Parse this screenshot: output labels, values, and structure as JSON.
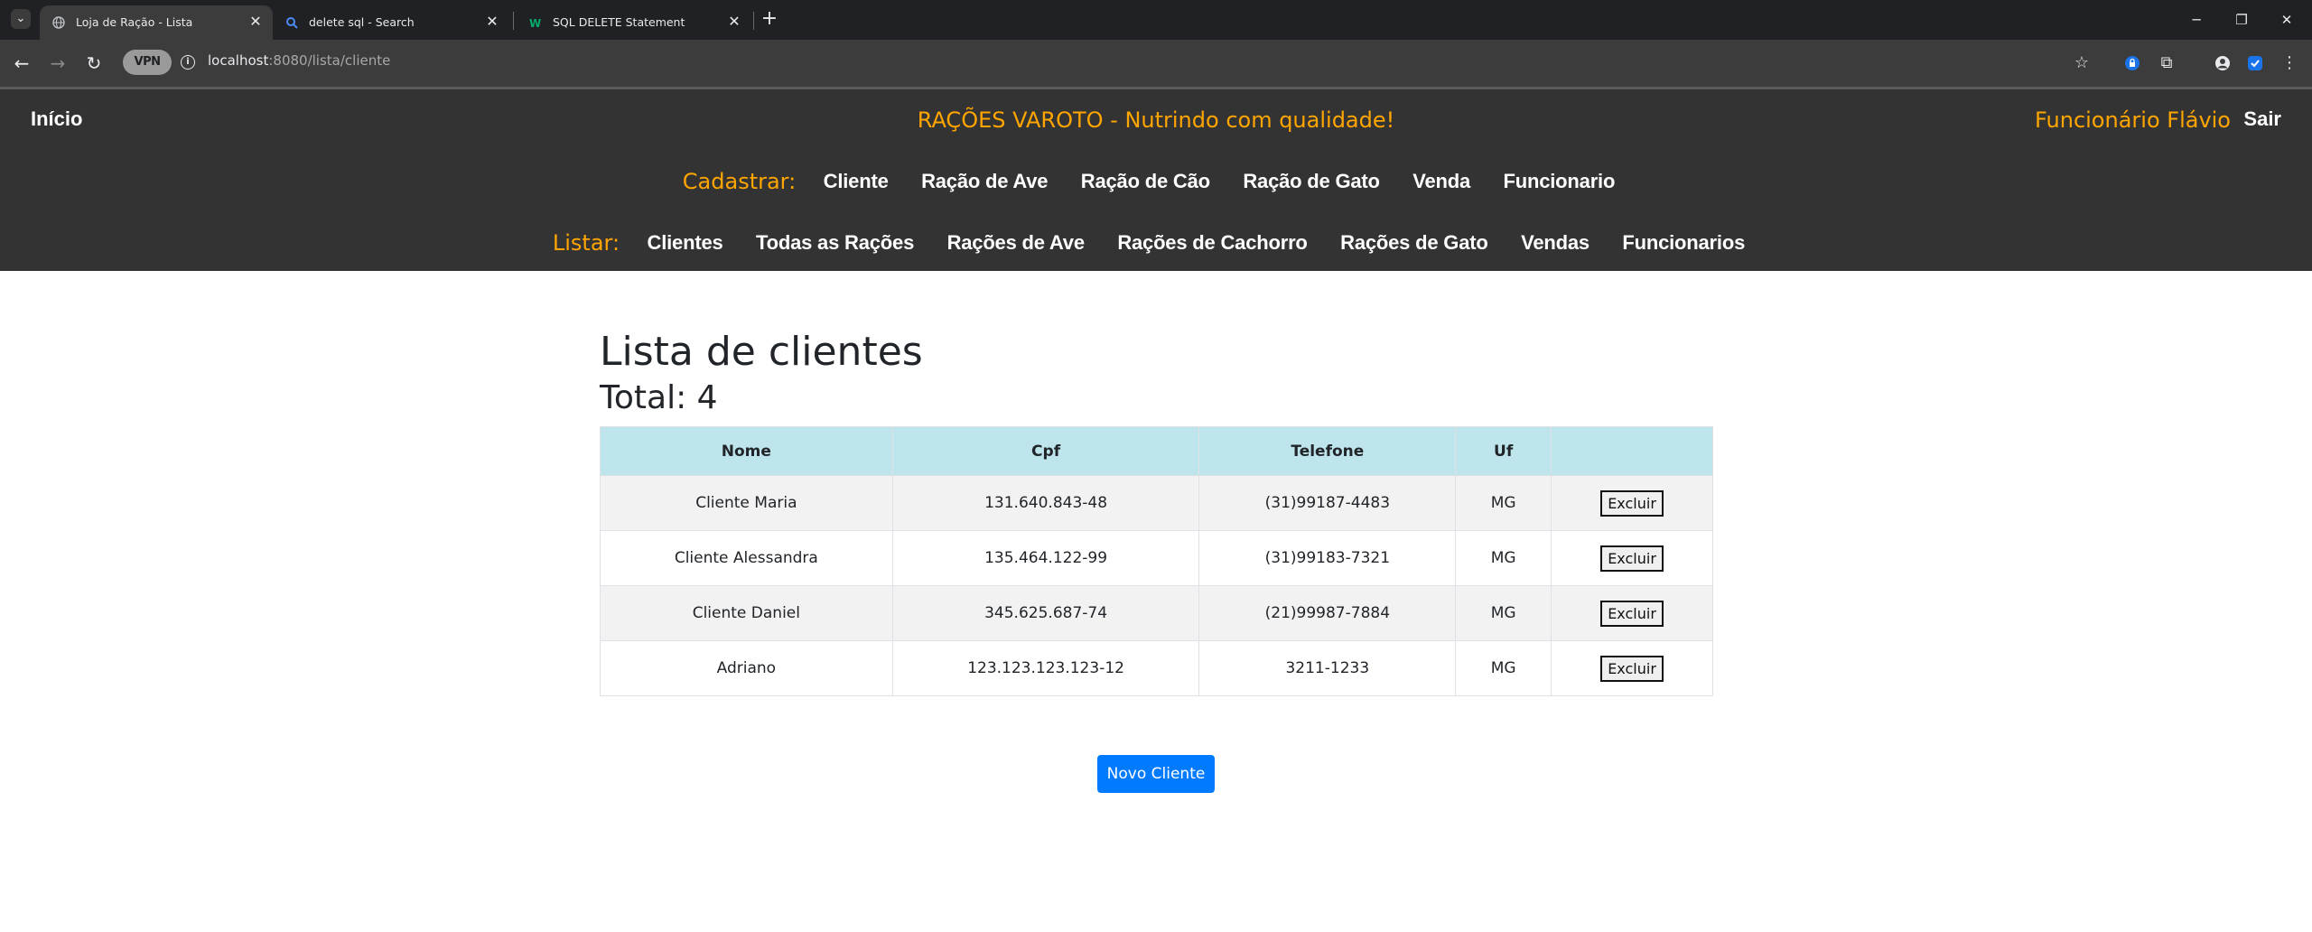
{
  "browser": {
    "tabs": [
      {
        "title": "Loja de Ração - Lista",
        "active": true
      },
      {
        "title": "delete sql - Search",
        "active": false
      },
      {
        "title": "SQL DELETE Statement",
        "active": false
      }
    ],
    "new_tab_glyph": "+",
    "vpn_label": "VPN",
    "url_host": "localhost",
    "url_rest": ":8080/lista/cliente",
    "window_controls": {
      "minimize": "─",
      "restore": "❐",
      "close": "✕"
    }
  },
  "header": {
    "home": "Início",
    "slogan": "RAÇÕES VAROTO - Nutrindo com qualidade!",
    "user": "Funcionário Flávio",
    "logout": "Sair",
    "register_label": "Cadastrar:",
    "register_links": [
      "Cliente",
      "Ração de Ave",
      "Ração de Cão",
      "Ração de Gato",
      "Venda",
      "Funcionario"
    ],
    "list_label": "Listar:",
    "list_links": [
      "Clientes",
      "Todas as Rações",
      "Rações de Ave",
      "Rações de Cachorro",
      "Rações de Gato",
      "Vendas",
      "Funcionarios"
    ]
  },
  "main": {
    "title": "Lista de clientes",
    "total_label": "Total: ",
    "total_value": "4",
    "table": {
      "columns": [
        "Nome",
        "Cpf",
        "Telefone",
        "Uf",
        ""
      ],
      "rows": [
        {
          "nome": "Cliente Maria",
          "cpf": "131.640.843-48",
          "telefone": "(31)99187-4483",
          "uf": "MG",
          "action": "Excluir"
        },
        {
          "nome": "Cliente Alessandra",
          "cpf": "135.464.122-99",
          "telefone": "(31)99183-7321",
          "uf": "MG",
          "action": "Excluir"
        },
        {
          "nome": "Cliente Daniel",
          "cpf": "345.625.687-74",
          "telefone": "(21)99987-7884",
          "uf": "MG",
          "action": "Excluir"
        },
        {
          "nome": "Adriano",
          "cpf": "123.123.123.123-12",
          "telefone": "3211-1233",
          "uf": "MG",
          "action": "Excluir"
        }
      ]
    },
    "new_button": "Novo Cliente"
  },
  "colors": {
    "accent_orange": "#ffa500",
    "header_bg": "#333333",
    "table_head_bg": "#bee5eb",
    "primary_button": "#007bff"
  }
}
